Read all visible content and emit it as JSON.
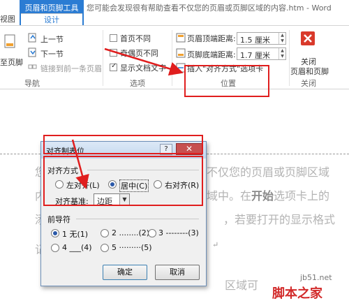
{
  "titlebar": {
    "context_group": "页眉和页脚工具",
    "tab_design": "设计",
    "tab_view_partial": "视图",
    "doc_title": "您可能会发现很有帮助查看不仅您的页眉或页脚区域的内容.htm - Word"
  },
  "ribbon": {
    "nav": {
      "goto_footer_partial": "至页脚",
      "prev_section": "上一节",
      "next_section": "下一节",
      "link_prev": "链接到前一条页眉",
      "group_label": "导航"
    },
    "options": {
      "first_page_diff": "首页不同",
      "odd_even_diff": "奇偶页不同",
      "show_doc_text": "显示文档文字",
      "show_doc_text_checked": true,
      "group_label": "选项"
    },
    "position": {
      "header_top_label": "页眉顶端距离:",
      "header_top_value": "1.5 厘米",
      "footer_bottom_label": "页脚底端距离:",
      "footer_bottom_value": "1.7 厘米",
      "insert_align_tab": "插入\"对齐方式\"选项卡",
      "group_label": "位置"
    },
    "close": {
      "close_label_1": "关闭",
      "close_label_2": "页眉和页脚",
      "group_label": "关闭"
    }
  },
  "document": {
    "line1_left": "您",
    "line1_right": "不仅您的页眉或页脚区域",
    "line2_left": "内",
    "line2_right_pre": "域中。在",
    "line2_right_bold": "开始",
    "line2_right_post": "选项卡上的",
    "line3_left": "添",
    "line3_right": "，若要打开的显示格式",
    "line4_left": "记",
    "line5_right": "区域可"
  },
  "dialog": {
    "title": "对齐制表位",
    "help": "?",
    "close": "✕",
    "alignment_section": "对齐方式",
    "align_left": "左对齐(L)",
    "align_center": "居中(C)",
    "align_right": "右对齐(R)",
    "selected_alignment": "center",
    "basis_label": "对齐基准:",
    "basis_value": "边距",
    "leader_section": "前导符",
    "leader_1": "1 无(1)",
    "leader_2": "2 ........(2)",
    "leader_3": "3 --------(3)",
    "leader_4": "4 ___(4)",
    "leader_5": "5 ·········(5)",
    "selected_leader": "1",
    "ok": "确定",
    "cancel": "取消"
  },
  "watermark": {
    "url": "jb51.net",
    "cn": "脚本之家"
  },
  "colors": {
    "accent": "#2b7cd3",
    "annotation_red": "#e01e1e"
  }
}
